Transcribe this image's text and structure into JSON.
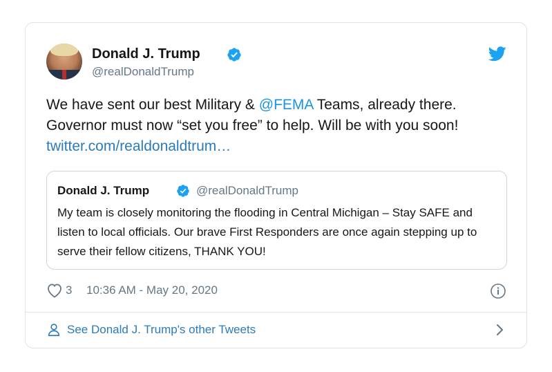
{
  "colors": {
    "link": "#2b7bb9",
    "mention": "#1b95e0",
    "verified": "#1da1f2",
    "muted": "#657786",
    "text": "#14171a"
  },
  "tweet": {
    "author_name": "Donald J. Trump",
    "author_handle": "@realDonaldTrump",
    "text_part1": "We have sent our best Military & ",
    "mention": "@FEMA",
    "text_part2": " Teams, already there. Governor must now “set you free” to help. Will be with you soon!",
    "link": "twitter.com/realdonaldtrum…",
    "likes": "3",
    "timestamp": "10:36 AM - May 20, 2020"
  },
  "quoted": {
    "author_name": "Donald J. Trump",
    "author_handle": "@realDonaldTrump",
    "text": "My team is closely monitoring the flooding in Central Michigan – Stay SAFE and listen to local officials. Our brave First Responders are once again stepping up to serve their fellow citizens, THANK YOU!"
  },
  "footer": {
    "label": "See Donald J. Trump's other Tweets"
  },
  "icons": {
    "verified": "verified-badge-icon",
    "bird": "twitter-bird-icon",
    "like": "heart-icon",
    "info": "info-icon",
    "profile": "person-icon",
    "chevron": "chevron-right-icon"
  }
}
